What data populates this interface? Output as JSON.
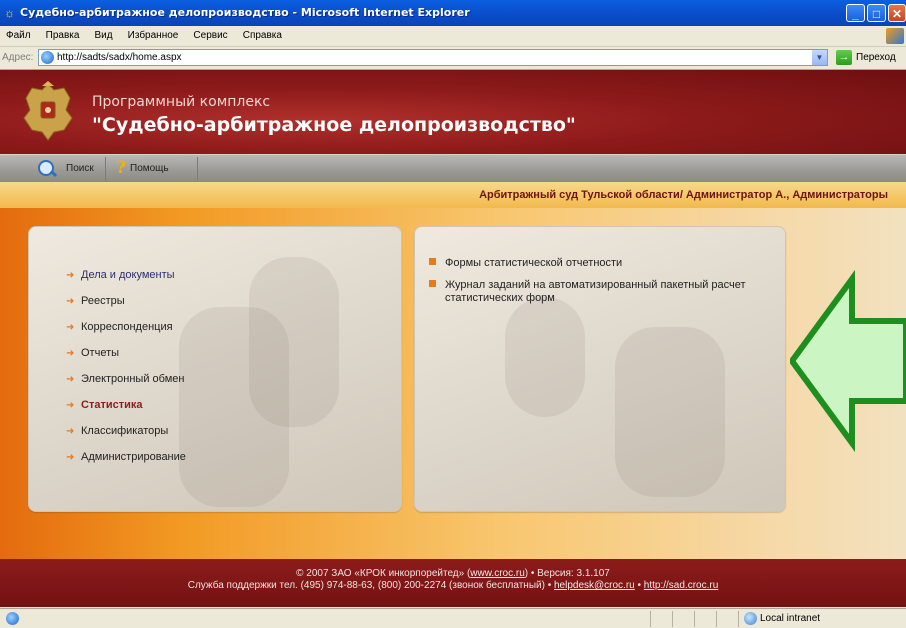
{
  "window": {
    "title": "Судебно-арбитражное делопроизводство - Microsoft Internet Explorer",
    "controls": [
      "minimize",
      "maximize",
      "close"
    ]
  },
  "menubar": {
    "items": [
      "Файл",
      "Правка",
      "Вид",
      "Избранное",
      "Сервис",
      "Справка"
    ]
  },
  "addressbar": {
    "label": "Адрес:",
    "url": "http://sadts/sadx/home.aspx",
    "go_label": "Переход"
  },
  "header": {
    "subtitle": "Программный комплекс",
    "title": "\"Судебно-арбитражное делопроизводство\""
  },
  "toolbar": {
    "search_label": "Поиск",
    "help_label": "Помощь"
  },
  "org": {
    "text": "Арбитражный суд Тульской области/ Администратор А., Администраторы"
  },
  "nav": {
    "items": [
      {
        "label": "Дела и документы"
      },
      {
        "label": "Реестры"
      },
      {
        "label": "Корреспонденция"
      },
      {
        "label": "Отчеты"
      },
      {
        "label": "Электронный обмен"
      },
      {
        "label": "Статистика",
        "active": true
      },
      {
        "label": "Классификаторы"
      },
      {
        "label": "Администрирование"
      }
    ]
  },
  "submenu": {
    "items": [
      {
        "label": "Формы статистической отчетности"
      },
      {
        "label": "Журнал заданий на автоматизированный пакетный расчет статистических форм"
      }
    ]
  },
  "footer": {
    "line1_prefix": "© 2007 ЗАО «КРОК инкорпорейтед» (",
    "line1_link": "www.croc.ru",
    "line1_suffix": ") • Версия: 3.1.107",
    "line2_prefix": "Служба поддержки тел. (495) 974-88-63, (800) 200-2274 (звонок бесплатный) • ",
    "line2_email": "helpdesk@croc.ru",
    "line2_sep": " • ",
    "line2_link": "http://sad.croc.ru"
  },
  "statusbar": {
    "zone": "Local intranet"
  },
  "colors": {
    "header_red": "#8d1a1a",
    "accent_orange": "#e9781c",
    "active_item": "#8a1f1f",
    "callout_arrow_fill": "#ccf5c4",
    "callout_arrow_stroke": "#1e8f1e"
  }
}
